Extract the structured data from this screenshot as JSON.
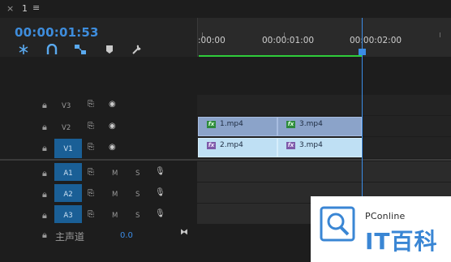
{
  "window": {
    "close_icon": "×",
    "tab_number": "1",
    "menu_icon": "≡"
  },
  "timecode": "00:00:01:53",
  "tools": [
    "snap-icon",
    "magnet-icon",
    "linked-selection-icon",
    "marker-icon",
    "wrench-icon"
  ],
  "ruler": {
    "labels": [
      ":00:00",
      "00:00:01:00",
      "00:00:02:00"
    ]
  },
  "tracks": {
    "v3": {
      "label": "V3"
    },
    "v2": {
      "label": "V2"
    },
    "v1": {
      "label": "V1"
    },
    "a1": {
      "label": "A1",
      "mute": "M",
      "solo": "S"
    },
    "a2": {
      "label": "A2",
      "mute": "M",
      "solo": "S"
    },
    "a3": {
      "label": "A3",
      "mute": "M",
      "solo": "S"
    }
  },
  "master": {
    "label": "主声道",
    "value": "0.0"
  },
  "clips": {
    "v2_a": {
      "name": "1.mp4",
      "fx": "fx"
    },
    "v2_b": {
      "name": "3.mp4",
      "fx": "fx"
    },
    "v1_a": {
      "name": "2.mp4",
      "fx": "fx"
    },
    "v1_b": {
      "name": "3.mp4",
      "fx": "fx"
    }
  },
  "watermark": {
    "brand": "PConline",
    "big": "IT百科"
  },
  "colors": {
    "accent": "#3b8ce6",
    "work_bar": "#2fcc3a",
    "patch": "#1a5f96"
  }
}
